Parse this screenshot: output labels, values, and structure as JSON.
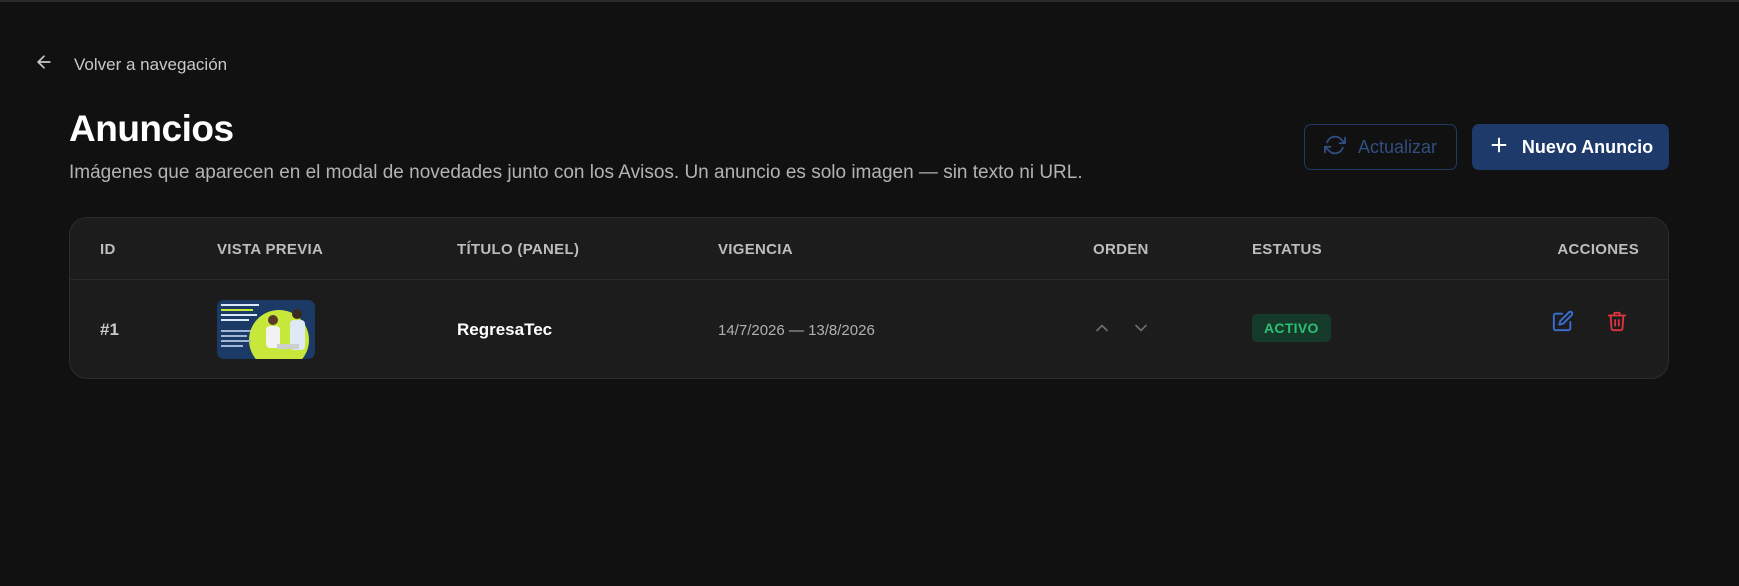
{
  "nav": {
    "back_label": "Volver a navegación",
    "back_icon": "arrow-left-icon"
  },
  "header": {
    "title": "Anuncios",
    "subtitle": "Imágenes que aparecen en el modal de novedades junto con los Avisos. Un anuncio es solo imagen — sin texto ni URL.",
    "refresh_label": "Actualizar",
    "refresh_icon": "refresh-icon",
    "new_label": "Nuevo Anuncio",
    "new_icon": "plus-icon"
  },
  "table": {
    "columns": [
      "ID",
      "VISTA PREVIA",
      "TÍTULO (PANEL)",
      "VIGENCIA",
      "ORDEN",
      "ESTATUS",
      "ACCIONES"
    ],
    "rows": [
      {
        "id": "#1",
        "title": "RegresaTec",
        "vigencia": "14/7/2026 — 13/8/2026",
        "status": "ACTIVO"
      }
    ]
  },
  "colors": {
    "background": "#111111",
    "card": "#1c1c1c",
    "primary": "#1e3a6b",
    "status_active_bg": "#163a2a",
    "status_active_fg": "#2bbf77",
    "edit": "#3b6fd8",
    "delete": "#e0343d"
  }
}
